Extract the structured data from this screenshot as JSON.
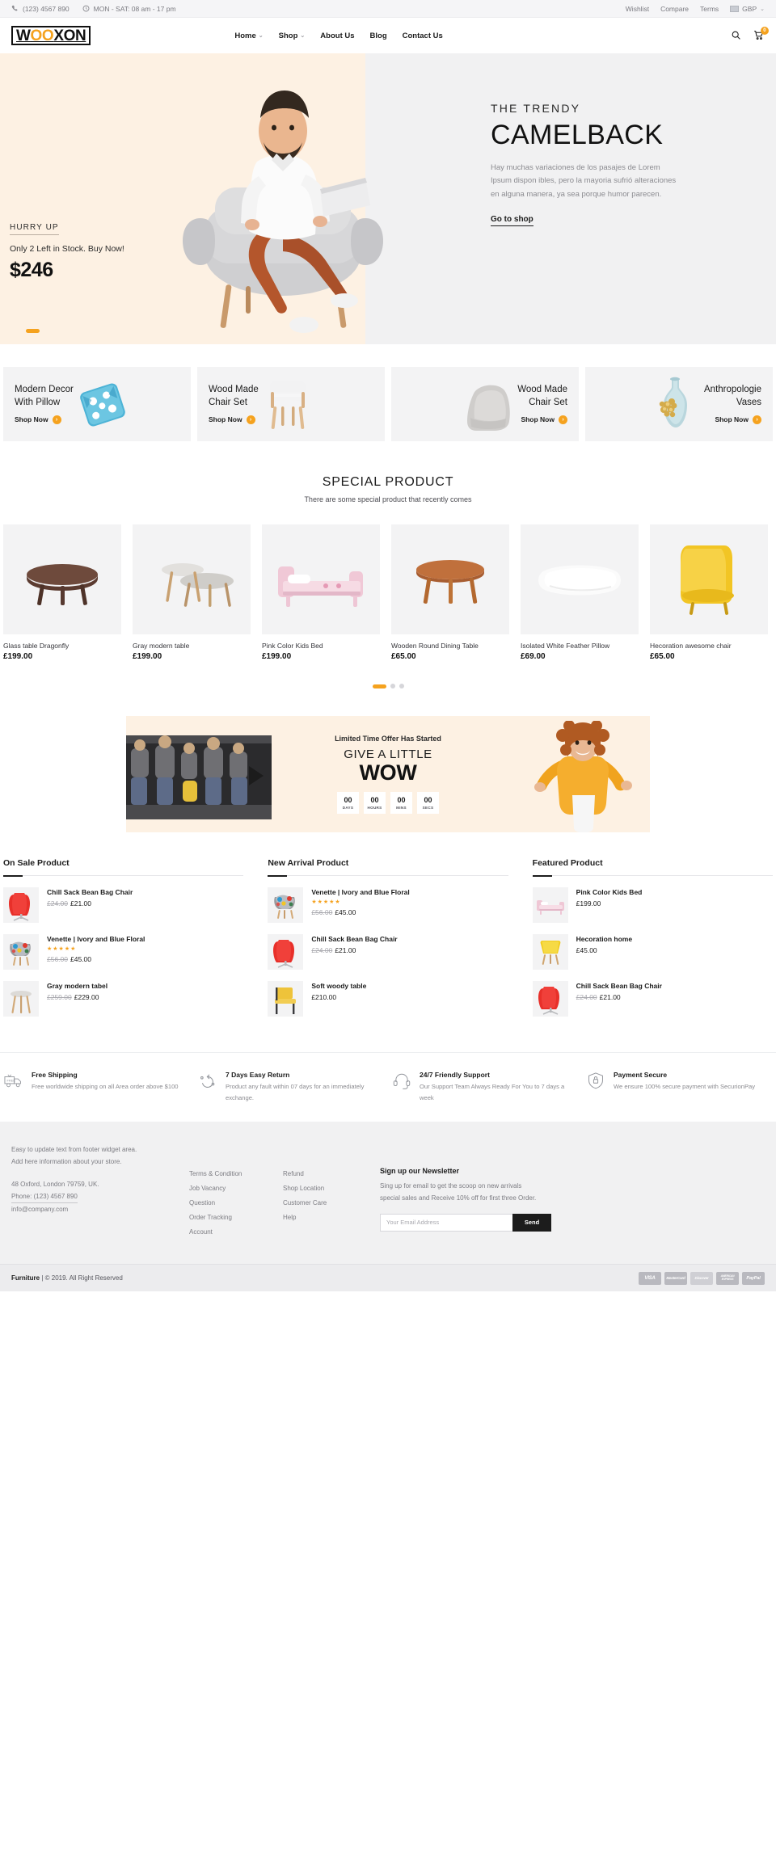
{
  "topbar": {
    "phone": "(123) 4567 890",
    "hours": "MON - SAT: 08 am - 17 pm",
    "links": [
      "Wishlist",
      "Compare",
      "Terms"
    ],
    "currency": "GBP"
  },
  "header": {
    "logo_pre": "W",
    "logo_oo": "OO",
    "logo_post": "XON",
    "nav": [
      {
        "label": "Home",
        "caret": "⌄"
      },
      {
        "label": "Shop",
        "caret": "⌄"
      },
      {
        "label": "About Us",
        "caret": ""
      },
      {
        "label": "Blog",
        "caret": ""
      },
      {
        "label": "Contact Us",
        "caret": ""
      }
    ],
    "cart_count": "0"
  },
  "hero": {
    "hurry": "HURRY UP",
    "stock": "Only 2 Left in Stock. Buy Now!",
    "price": "$246",
    "kicker": "THE TRENDY",
    "title": "CAMELBACK",
    "desc": "Hay muchas variaciones de los pasajes de Lorem Ipsum dispon ibles, pero la mayoria sufrió alteraciones en alguna manera, ya sea porque humor parecen.",
    "cta": "Go to shop"
  },
  "categories": [
    {
      "title": "Modern Decor\nWith Pillow",
      "shop": "Shop Now",
      "image": "pillow-blue",
      "align": "left"
    },
    {
      "title": "Wood Made\nChair Set",
      "shop": "Shop Now",
      "image": "wood-chair",
      "align": "left"
    },
    {
      "title": "Wood Made\nChair Set",
      "shop": "Shop Now",
      "image": "bean-bag",
      "align": "right"
    },
    {
      "title": "Anthropologie\nVases",
      "shop": "Shop Now",
      "image": "blue-vase",
      "align": "right"
    }
  ],
  "special": {
    "title": "SPECIAL PRODUCT",
    "subtitle": "There are some special product that recently comes",
    "products": [
      {
        "name": "Glass table Dragonfly",
        "price": "£199.00",
        "image": "dark-round-table"
      },
      {
        "name": "Gray modern table",
        "price": "£199.00",
        "image": "gray-nest-table"
      },
      {
        "name": "Pink Color Kids Bed",
        "price": "£199.00",
        "image": "pink-kids-bed"
      },
      {
        "name": "Wooden Round Dining Table",
        "price": "£65.00",
        "image": "wooden-dining-table"
      },
      {
        "name": "Isolated White Feather Pillow",
        "price": "£69.00",
        "image": "white-pillow"
      },
      {
        "name": "Hecoration awesome chair",
        "price": "£65.00",
        "image": "yellow-wing-chair"
      }
    ],
    "dots": 3,
    "active_dot": 0
  },
  "wow": {
    "kicker": "Limited Time Offer Has Started",
    "line1": "GIVE A LITTLE",
    "line2": "WOW",
    "countdown": [
      {
        "value": "00",
        "label": "DAYS"
      },
      {
        "value": "00",
        "label": "HOURS"
      },
      {
        "value": "00",
        "label": "MINS"
      },
      {
        "value": "00",
        "label": "SECS"
      }
    ]
  },
  "lists": [
    {
      "title": "On Sale Product",
      "items": [
        {
          "name": "Chill Sack Bean Bag Chair",
          "old": "£24.00",
          "price": "£21.00",
          "stars": "",
          "image": "red-egg-chair"
        },
        {
          "name": "Venette | Ivory and Blue Floral",
          "old": "£56.00",
          "price": "£45.00",
          "stars": "★★★★★",
          "image": "floral-chair"
        },
        {
          "name": "Gray modern tabel",
          "old": "£259.00",
          "price": "£229.00",
          "stars": "",
          "image": "gray-stool-table"
        }
      ]
    },
    {
      "title": "New Arrival Product",
      "items": [
        {
          "name": "Venette | Ivory and Blue Floral",
          "old": "£56.00",
          "price": "£45.00",
          "stars": "★★★★★",
          "image": "floral-chair"
        },
        {
          "name": "Chill Sack Bean Bag Chair",
          "old": "£24.00",
          "price": "£21.00",
          "stars": "",
          "image": "red-egg-chair"
        },
        {
          "name": "Soft woody table",
          "old": "",
          "price": "£210.00",
          "stars": "",
          "image": "yellow-side-chair"
        }
      ]
    },
    {
      "title": "Featured Product",
      "items": [
        {
          "name": "Pink Color Kids Bed",
          "old": "",
          "price": "£199.00",
          "stars": "",
          "image": "pink-kids-bed"
        },
        {
          "name": "Hecoration home",
          "old": "",
          "price": "£45.00",
          "stars": "",
          "image": "yellow-eames-chair"
        },
        {
          "name": "Chill Sack Bean Bag Chair",
          "old": "£24.00",
          "price": "£21.00",
          "stars": "",
          "image": "red-egg-chair"
        }
      ]
    }
  ],
  "services": [
    {
      "icon": "truck-icon",
      "title": "Free Shipping",
      "desc": "Free worldwide shipping on all Area order above $100"
    },
    {
      "icon": "return-arrow-icon",
      "title": "7 Days Easy Return",
      "desc": "Product any fault within 07 days for an immediately exchange."
    },
    {
      "icon": "headset-icon",
      "title": "24/7 Friendly Support",
      "desc": "Our Support Team Always Ready For You to 7 days a week"
    },
    {
      "icon": "shield-lock-icon",
      "title": "Payment Secure",
      "desc": "We ensure 100% secure payment with SecurionPay"
    }
  ],
  "footer": {
    "about_line1": "Easy to update text from footer widget area.",
    "about_line2": "Add here information about your store.",
    "address": "48 Oxford, London 79759, UK.",
    "phone": "Phone: (123) 4567 890",
    "email": "info@company.com",
    "links_col1": [
      "Terms & Condition",
      "Job Vacancy",
      "Question",
      "Order Tracking",
      "Account"
    ],
    "links_col2": [
      "Refund",
      "Shop Location",
      "Customer Care",
      "Help"
    ],
    "newsletter_title": "Sign up our Newsletter",
    "newsletter_desc": "Sing up for email to get the scoop on new arrivals special sales and Receive 10% off for first three Order.",
    "email_placeholder": "Your Email Address",
    "send_label": "Send",
    "copyright_brand": "Furniture",
    "copyright_rest": "| © 2019. All Right Reserved",
    "payments": [
      "VISA",
      "MasterCard",
      "Discover",
      "AMERICAN EXPRESS",
      "PayPal"
    ]
  },
  "colors": {
    "accent": "#f5a21e",
    "hero_cream": "#fdf1e3",
    "panel_gray": "#f3f3f4",
    "dark": "#1c1c1c"
  }
}
